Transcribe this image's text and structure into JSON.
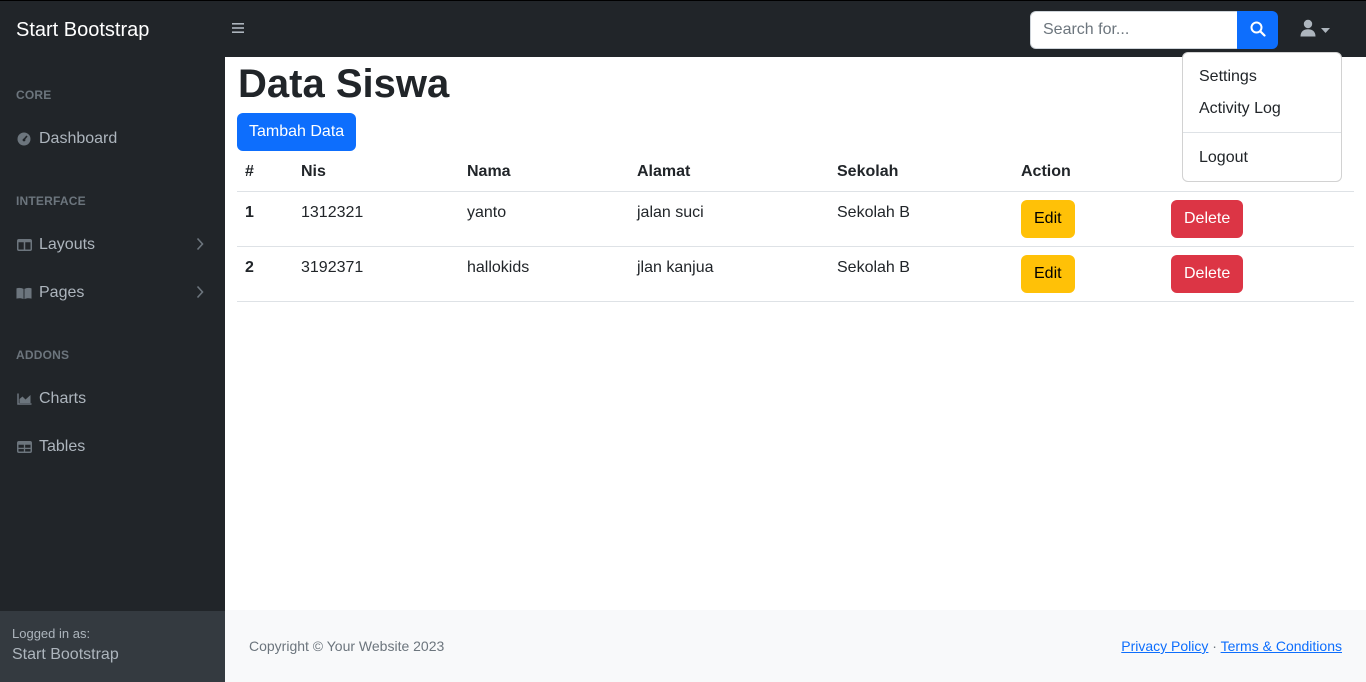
{
  "navbar": {
    "brand": "Start Bootstrap",
    "toggle_icon": "hamburger-icon",
    "search": {
      "placeholder": "Search for...",
      "value": ""
    },
    "search_button_icon": "search-icon",
    "user_icon": "user-icon"
  },
  "sidebar": {
    "sections": [
      {
        "heading": "CORE",
        "items": [
          {
            "label": "Dashboard",
            "icon": "tachometer-icon",
            "has_chevron": false
          }
        ]
      },
      {
        "heading": "INTERFACE",
        "items": [
          {
            "label": "Layouts",
            "icon": "columns-icon",
            "has_chevron": true
          },
          {
            "label": "Pages",
            "icon": "book-open-icon",
            "has_chevron": true
          }
        ]
      },
      {
        "heading": "ADDONS",
        "items": [
          {
            "label": "Charts",
            "icon": "area-chart-icon",
            "has_chevron": false
          },
          {
            "label": "Tables",
            "icon": "table-icon",
            "has_chevron": false
          }
        ]
      }
    ],
    "footer": {
      "label": "Logged in as:",
      "user": "Start Bootstrap"
    }
  },
  "main": {
    "title": "Data Siswa",
    "add_button": "Tambah Data",
    "table": {
      "headers": [
        "#",
        "Nis",
        "Nama",
        "Alamat",
        "Sekolah",
        "Action"
      ],
      "rows": [
        {
          "no": "1",
          "nis": "1312321",
          "nama": "yanto",
          "alamat": "jalan suci",
          "sekolah": "Sekolah B"
        },
        {
          "no": "2",
          "nis": "3192371",
          "nama": "hallokids",
          "alamat": "jlan kanjua",
          "sekolah": "Sekolah B"
        }
      ],
      "edit_label": "Edit",
      "delete_label": "Delete"
    }
  },
  "footer": {
    "copyright": "Copyright © Your Website 2023",
    "privacy": "Privacy Policy",
    "separator": "·",
    "terms": "Terms & Conditions"
  },
  "dropdown": {
    "items": [
      "Settings",
      "Activity Log"
    ],
    "logout": "Logout"
  },
  "colors": {
    "dark": "#212529",
    "primary": "#0d6efd",
    "warning": "#ffc107",
    "danger": "#dc3545",
    "footer_bg": "#f8f9fa"
  }
}
